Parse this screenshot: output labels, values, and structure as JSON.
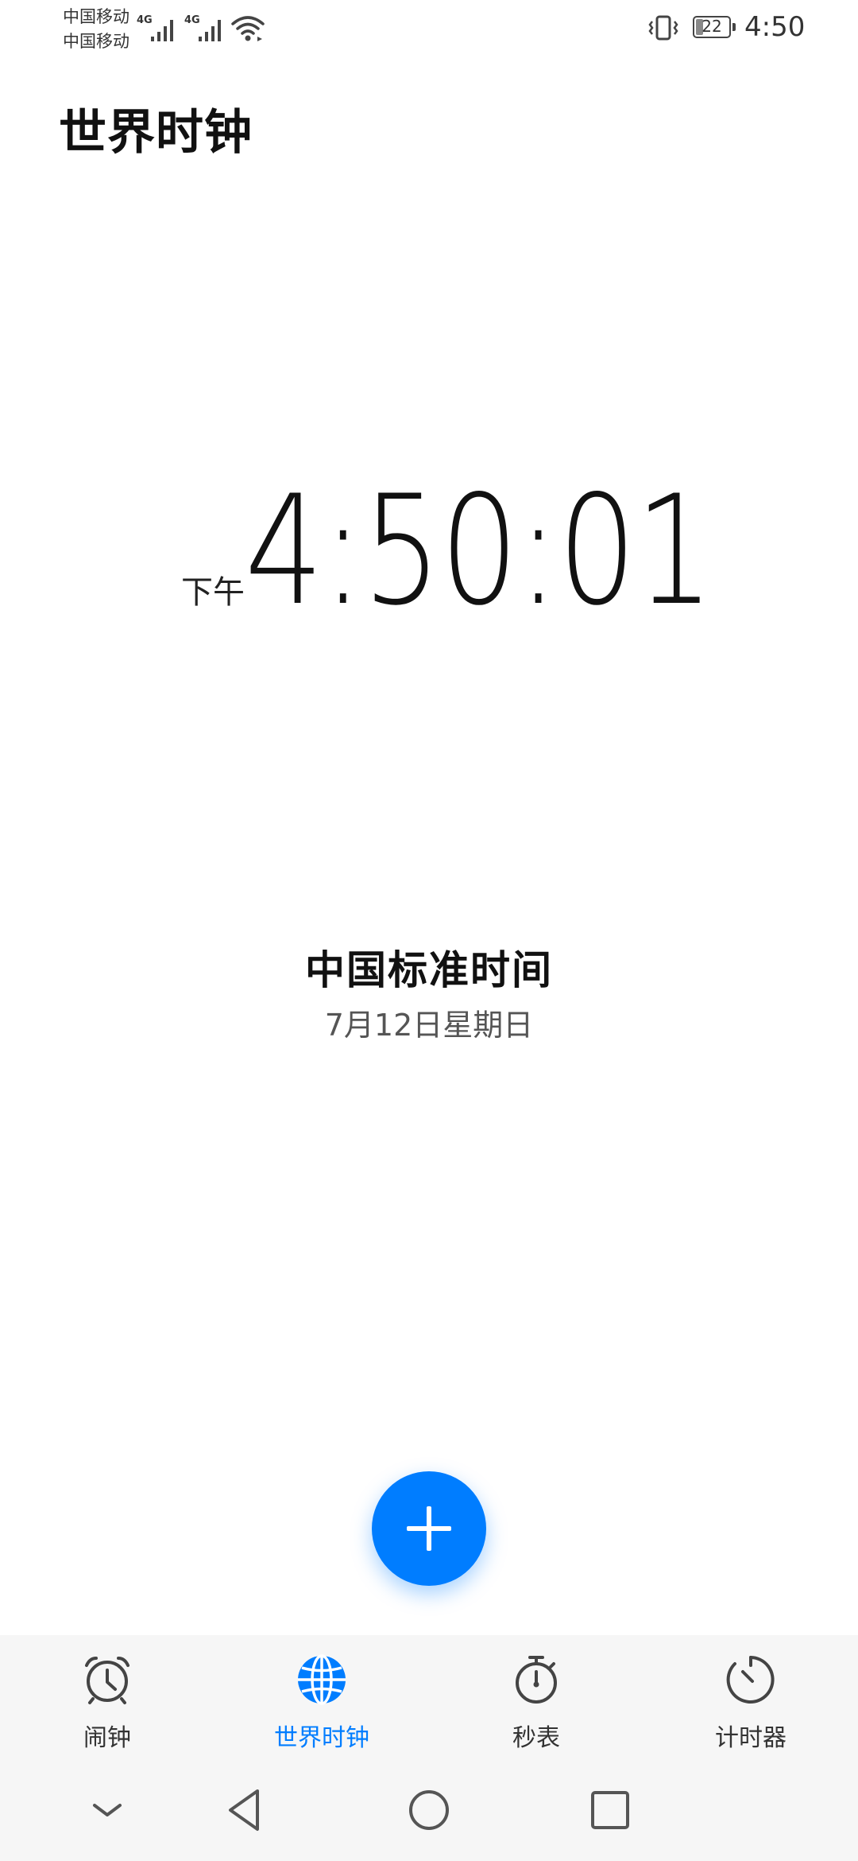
{
  "status_bar": {
    "carrier_1": "中国移动",
    "carrier_2": "中国移动",
    "network_1": "4G",
    "network_2": "4G",
    "battery_level": "22",
    "time": "4:50"
  },
  "header": {
    "title": "世界时钟"
  },
  "clock": {
    "ampm": "下午",
    "time": "4:50:01"
  },
  "timezone": {
    "name": "中国标准时间",
    "date": "7月12日星期日"
  },
  "fab": {
    "icon": "plus-icon"
  },
  "tabs": [
    {
      "label": "闹钟",
      "icon": "alarm-clock-icon",
      "active": false
    },
    {
      "label": "世界时钟",
      "icon": "globe-icon",
      "active": true
    },
    {
      "label": "秒表",
      "icon": "stopwatch-icon",
      "active": false
    },
    {
      "label": "计时器",
      "icon": "timer-icon",
      "active": false
    }
  ],
  "navigation": {
    "buttons": [
      "collapse-icon",
      "back-icon",
      "home-icon",
      "recents-icon"
    ]
  },
  "colors": {
    "accent": "#007dff",
    "tab_inactive": "#333333",
    "tab_bar_bg": "#f6f6f6"
  }
}
